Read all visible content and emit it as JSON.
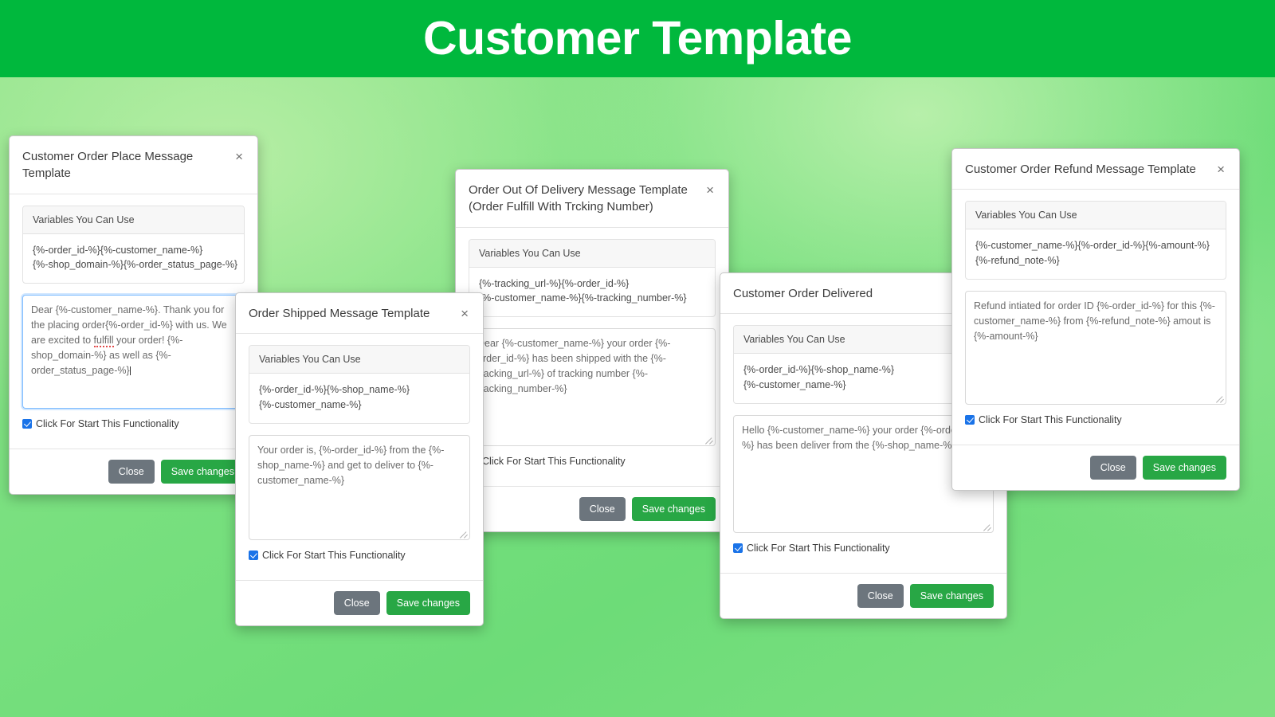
{
  "header": {
    "title": "Customer Template",
    "bg_color": "#00b83d",
    "text_color": "#ffffff"
  },
  "theme": {
    "page_bg_green": "#6ddc78",
    "btn_close_color": "#6c757d",
    "btn_save_color": "#28a745",
    "checkbox_color": "#1a73e8",
    "focus_border_color": "#80bdff"
  },
  "common": {
    "variables_label": "Variables You Can Use",
    "checkbox_label": "Click For Start This Functionality",
    "close_label": "Close",
    "save_label": "Save changes",
    "close_icon": "×"
  },
  "modals": [
    {
      "id": "order-place",
      "title": "Customer Order Place Message Template",
      "variables_label": "Variables You Can Use",
      "variables_lines": [
        "{%-order_id-%}{%-customer_name-%}",
        "{%-shop_domain-%}{%-order_status_page-%}"
      ],
      "message": "Dear {%-customer_name-%}. Thank you for the placing order{%-order_id-%} with us. We are excited to fulfill your order! {%-shop_domain-%} as well as {%-order_status_page-%}",
      "checkbox_label": "Click For Start This Functionality",
      "checkbox_checked": true,
      "focused": true,
      "close_label": "Close",
      "save_label": "Save changes"
    },
    {
      "id": "out-delivery",
      "title": "Order Out Of Delivery Message Template (Order Fulfill With Trcking Number)",
      "variables_label": "Variables You Can Use",
      "variables_lines": [
        "{%-tracking_url-%}{%-order_id-%}",
        "{%-customer_name-%}{%-tracking_number-%}"
      ],
      "message": "Dear {%-customer_name-%} your order {%-order_id-%} has been shipped with the {%-tracking_url-%} of tracking number {%-tracking_number-%}",
      "checkbox_label": "Click For Start This Functionality",
      "checkbox_checked": true,
      "focused": false,
      "close_label": "Close",
      "save_label": "Save changes"
    },
    {
      "id": "order-shipped",
      "title": "Order Shipped Message Template",
      "variables_label": "Variables You Can Use",
      "variables_lines": [
        "{%-order_id-%}{%-shop_name-%}",
        "{%-customer_name-%}"
      ],
      "message": "Your order is, {%-order_id-%} from the {%-shop_name-%} and get to deliver to {%-customer_name-%}",
      "checkbox_label": "Click For Start This Functionality",
      "checkbox_checked": true,
      "focused": false,
      "close_label": "Close",
      "save_label": "Save changes"
    },
    {
      "id": "delivered",
      "title": "Customer Order Delivered",
      "variables_label": "Variables You Can Use",
      "variables_lines": [
        "{%-order_id-%}{%-shop_name-%}",
        "{%-customer_name-%}"
      ],
      "message": "Hello {%-customer_name-%} your order {%-order_id-%} has been deliver from the {%-shop_name-%}",
      "checkbox_label": "Click For Start This Functionality",
      "checkbox_checked": true,
      "focused": false,
      "close_label": "Close",
      "save_label": "Save changes"
    },
    {
      "id": "refund",
      "title": "Customer Order Refund Message Template",
      "variables_label": "Variables You Can Use",
      "variables_lines": [
        "{%-customer_name-%}{%-order_id-%}{%-amount-%}",
        "{%-refund_note-%}"
      ],
      "message": "Refund intiated for order ID {%-order_id-%} for this {%-customer_name-%} from {%-refund_note-%} amout is {%-amount-%}",
      "checkbox_label": "Click For Start This Functionality",
      "checkbox_checked": true,
      "focused": false,
      "close_label": "Close",
      "save_label": "Save changes"
    }
  ]
}
